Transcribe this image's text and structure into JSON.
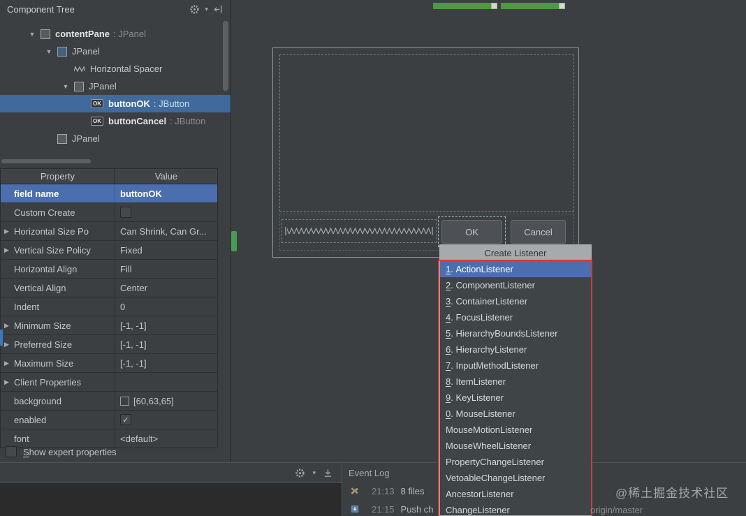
{
  "colors": {
    "panel_background": "#3c3f41",
    "selection_blue": "#4b6eaf",
    "annotation_red": "#d23a3a",
    "indicator_green": "#4a9c54",
    "background_property_value": "#3c3f41"
  },
  "component_tree": {
    "title": "Component Tree",
    "items": [
      {
        "label": "contentPane",
        "type": ": JPanel",
        "level": 0,
        "expanded": true,
        "icon": "panel",
        "bold": true
      },
      {
        "label": "JPanel",
        "level": 1,
        "expanded": true,
        "icon": "panel",
        "blue": true
      },
      {
        "label": "Horizontal Spacer",
        "level": 2,
        "icon": "spacer"
      },
      {
        "label": "JPanel",
        "level": 2,
        "expanded": true,
        "icon": "panel"
      },
      {
        "label": "buttonOK",
        "type": ": JButton",
        "level": 3,
        "icon": "button",
        "bold": true,
        "selected": true
      },
      {
        "label": "buttonCancel",
        "type": ": JButton",
        "level": 3,
        "icon": "button",
        "bold": true
      },
      {
        "label": "JPanel",
        "level": 1,
        "icon": "panel"
      }
    ]
  },
  "properties": {
    "headers": [
      "Property",
      "Value"
    ],
    "rows": [
      {
        "name": "field name",
        "value": "buttonOK",
        "selected": true
      },
      {
        "name": "Custom Create",
        "value_type": "checkbox",
        "checked": false
      },
      {
        "name": "Horizontal Size Po",
        "value": "Can Shrink, Can Gr...",
        "expandable": true
      },
      {
        "name": "Vertical Size Policy",
        "value": "Fixed",
        "expandable": true
      },
      {
        "name": "Horizontal Align",
        "value": "Fill"
      },
      {
        "name": "Vertical Align",
        "value": "Center"
      },
      {
        "name": "Indent",
        "value": "0"
      },
      {
        "name": "Minimum Size",
        "value": "[-1, -1]",
        "expandable": true
      },
      {
        "name": "Preferred Size",
        "value": "[-1, -1]",
        "expandable": true
      },
      {
        "name": "Maximum Size",
        "value": "[-1, -1]",
        "expandable": true
      },
      {
        "name": "Client Properties",
        "value": "",
        "expandable": true
      },
      {
        "name": "background",
        "value": "[60,63,65]",
        "swatch": true
      },
      {
        "name": "enabled",
        "value_type": "checkbox",
        "checked": true
      },
      {
        "name": "font",
        "value": "<default>"
      }
    ],
    "expert_checkbox_label": "Show expert properties"
  },
  "designer": {
    "ok_label": "OK",
    "cancel_label": "Cancel"
  },
  "listener_popup": {
    "title": "Create Listener",
    "items": [
      {
        "mnemonic": "1",
        "label": "ActionListener",
        "selected": true
      },
      {
        "mnemonic": "2",
        "label": "ComponentListener"
      },
      {
        "mnemonic": "3",
        "label": "ContainerListener"
      },
      {
        "mnemonic": "4",
        "label": "FocusListener"
      },
      {
        "mnemonic": "5",
        "label": "HierarchyBoundsListener"
      },
      {
        "mnemonic": "6",
        "label": "HierarchyListener"
      },
      {
        "mnemonic": "7",
        "label": "InputMethodListener"
      },
      {
        "mnemonic": "8",
        "label": "ItemListener"
      },
      {
        "mnemonic": "9",
        "label": "KeyListener"
      },
      {
        "mnemonic": "0",
        "label": "MouseListener"
      },
      {
        "mnemonic": "",
        "label": "MouseMotionListener"
      },
      {
        "mnemonic": "",
        "label": "MouseWheelListener"
      },
      {
        "mnemonic": "",
        "label": "PropertyChangeListener"
      },
      {
        "mnemonic": "",
        "label": "VetoableChangeListener"
      },
      {
        "mnemonic": "",
        "label": "AncestorListener"
      },
      {
        "mnemonic": "",
        "label": "ChangeListener"
      }
    ]
  },
  "event_log": {
    "title": "Event Log",
    "entries": [
      {
        "time": "21:13",
        "text": "8 files",
        "icon": "build"
      },
      {
        "time": "21:15",
        "text": "Push ch",
        "icon": "vcs"
      }
    ]
  },
  "watermark": "@稀土掘金技术社区",
  "branch": "origin/master"
}
